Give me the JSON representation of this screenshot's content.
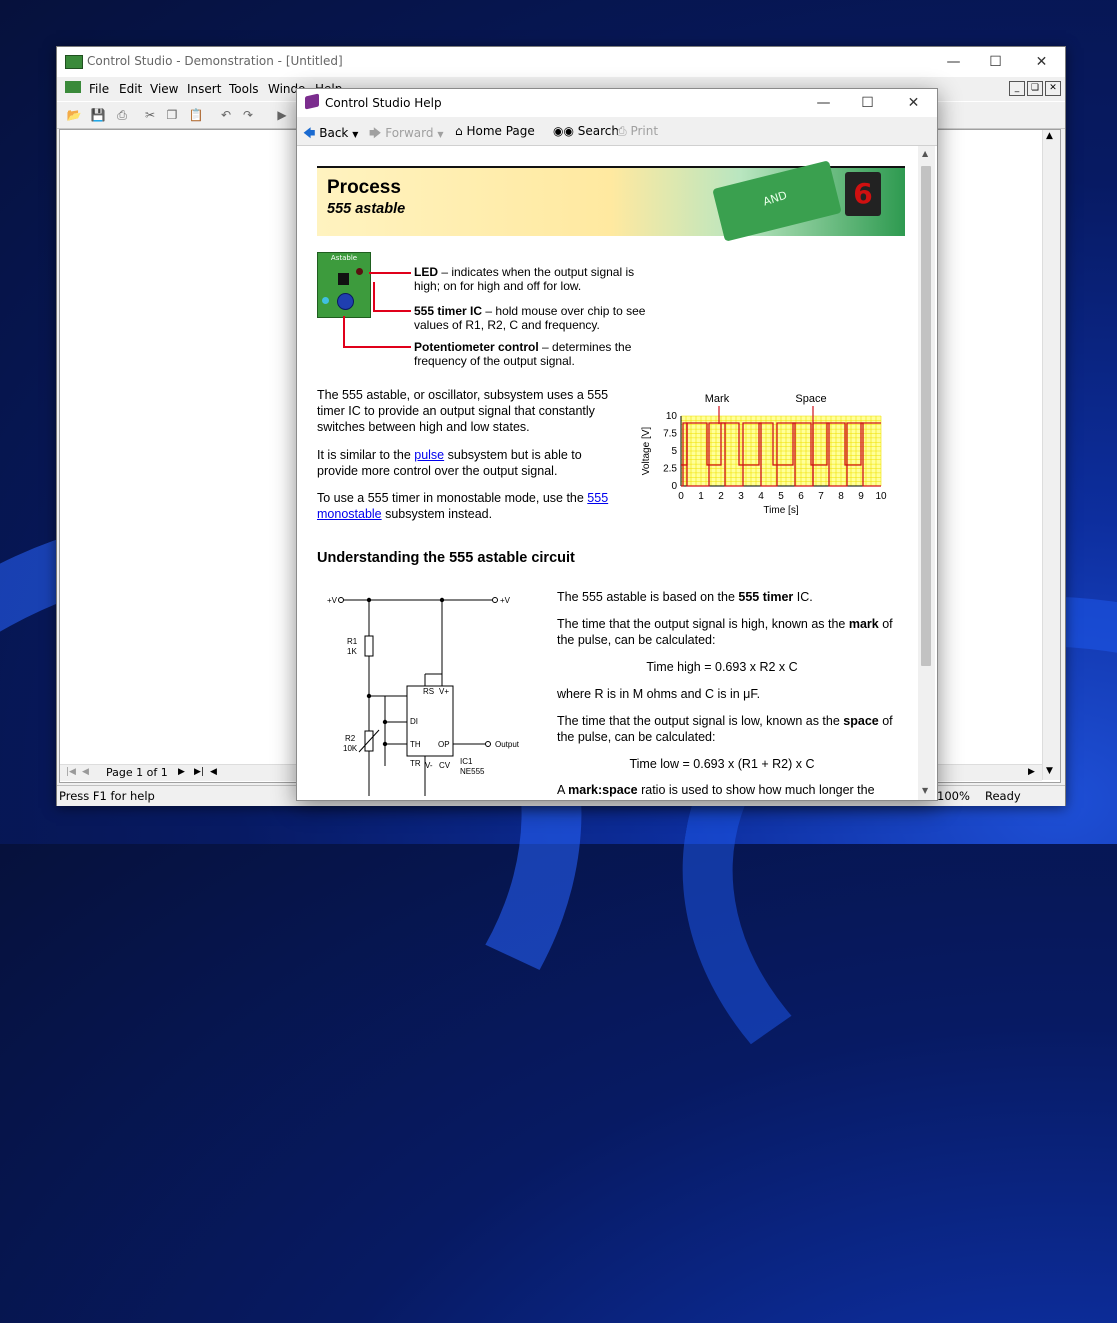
{
  "main_window": {
    "title": "Control Studio - Demonstration - [Untitled]",
    "menu": [
      "File",
      "Edit",
      "View",
      "Insert",
      "Tools",
      "Windo",
      "Help"
    ],
    "pager": {
      "label": "Page 1 of 1"
    },
    "status": {
      "hint": "Press F1 for help",
      "zoom": "100%",
      "state": "Ready"
    }
  },
  "help_window": {
    "title": "Control Studio Help",
    "toolbar": {
      "back": "Back",
      "forward": "Forward",
      "home": "Home Page",
      "search": "Search",
      "print": "Print"
    },
    "banner": {
      "title": "Process",
      "subtitle": "555 astable",
      "decor": "AND"
    },
    "board_label": "Astable",
    "callouts": [
      {
        "term": "LED",
        "sep": " – ",
        "desc": " indicates when the output signal is high; on for high and off for low."
      },
      {
        "term": "555 timer IC",
        "sep": " – ",
        "desc": " hold mouse over chip to see values of R1, R2, C and frequency."
      },
      {
        "term": "Potentiometer control",
        "sep": " – ",
        "desc": " determines the frequency of the output signal."
      }
    ],
    "intro": {
      "p1": "The 555 astable, or oscillator, subsystem uses a 555 timer IC to provide an output signal that constantly switches between high and low states.",
      "p2_pre": "It is similar to the ",
      "p2_link": "pulse",
      "p2_post": " subsystem but is able to provide more control over the output signal.",
      "p3_pre": "To use a 555 timer in monostable mode, use the ",
      "p3_link": "555 monostable",
      "p3_post": " subsystem instead."
    },
    "section_heading": "Understanding the 555 astable circuit",
    "explain": {
      "p1_pre": "The 555 astable is based on the ",
      "p1_bold": "555 timer",
      "p1_post": " IC.",
      "p2_pre": "The time that the output signal is high, known as the ",
      "p2_bold": "mark",
      "p2_post": " of the pulse, can be calculated:",
      "eq1": "Time high = 0.693 x R2 x C",
      "p3": "where R is in M ohms and C is in μF.",
      "p4_pre": "The time that the output signal is low, known as the ",
      "p4_bold": "space",
      "p4_post": " of the pulse, can be calculated:",
      "eq2": "Time low = 0.693 x (R1 + R2) x C",
      "p5_pre": "A ",
      "p5_bold": "mark:space",
      "p5_post": " ratio is used to show how much longer the"
    },
    "circuit": {
      "vplus_left": "+V",
      "vplus_right": "+V",
      "r1": "R1",
      "r1v": "1K",
      "r2": "R2",
      "r2v": "10K",
      "pins": [
        "DI",
        "RS",
        "V+",
        "TH",
        "OP",
        "TR",
        "V-",
        "CV"
      ],
      "output": "Output",
      "ic": "IC1",
      "ic_part": "NE555"
    }
  },
  "chart_data": {
    "type": "line",
    "title": "",
    "annotations": [
      "Mark",
      "Space"
    ],
    "xlabel": "Time [s]",
    "ylabel": "Voltage [V]",
    "xlim": [
      0,
      10
    ],
    "ylim": [
      0,
      10
    ],
    "xticks": [
      "0",
      "1",
      "2",
      "3",
      "4",
      "5",
      "6",
      "7",
      "8",
      "9",
      "10"
    ],
    "yticks": [
      "0",
      "2.5",
      "5",
      "7.5",
      "10"
    ],
    "grid": true,
    "series": [
      {
        "x": [
          0,
          0.1,
          0.1,
          0.3,
          0.3,
          1.4,
          1.4,
          2.2,
          2.2,
          3.1,
          3.1,
          4.0,
          4.0,
          4.8,
          4.8,
          5.7,
          5.7,
          6.6,
          6.6,
          7.4,
          7.4,
          8.3,
          8.3,
          9.1,
          9.1,
          10
        ],
        "values": [
          0,
          0,
          9,
          9,
          0,
          0,
          9,
          9,
          0,
          0,
          9,
          9,
          0,
          0,
          9,
          9,
          0,
          0,
          9,
          9,
          0,
          0,
          9,
          9,
          0,
          0
        ]
      },
      {
        "x": [
          0,
          0.3,
          0.3,
          1.3,
          1.3,
          2.0,
          2.0,
          2.9,
          2.9,
          3.9,
          3.9,
          4.6,
          4.6,
          5.6,
          5.6,
          6.5,
          6.5,
          7.3,
          7.3,
          8.2,
          8.2,
          9.0,
          9.0,
          10
        ],
        "values": [
          3,
          3,
          9,
          9,
          3,
          3,
          9,
          9,
          3,
          3,
          9,
          9,
          3,
          3,
          9,
          9,
          3,
          3,
          9,
          9,
          3,
          3,
          9,
          9
        ]
      }
    ]
  },
  "colors": {
    "accent_red": "#e0001a",
    "pcb_green": "#3d9b3d",
    "chart_grid": "#f0e000",
    "chart_bg": "#ffff99"
  }
}
